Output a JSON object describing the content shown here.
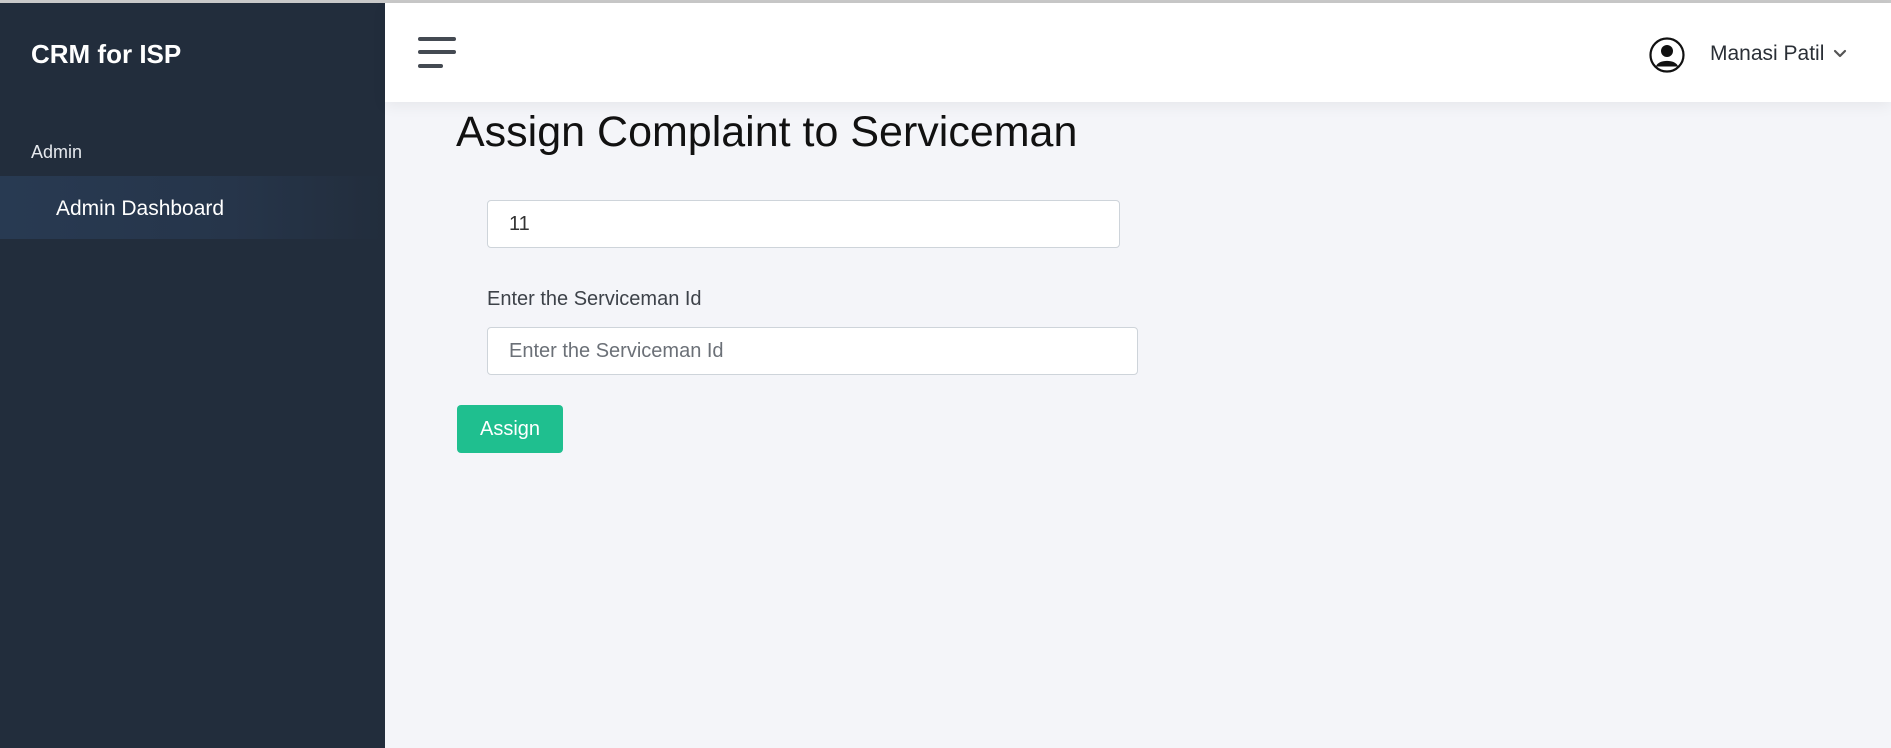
{
  "sidebar": {
    "brand": "CRM for ISP",
    "section_label": "Admin",
    "items": [
      {
        "label": "Admin Dashboard"
      }
    ],
    "background": "#222d3c"
  },
  "topbar": {
    "menu_icon": "hamburger-icon",
    "user_icon": "user-circle-icon",
    "user_name": "Manasi Patil",
    "dropdown_icon": "chevron-down-icon"
  },
  "main": {
    "title": "Assign Complaint to Serviceman",
    "complaint_field": {
      "value": "11"
    },
    "serviceman_field": {
      "label": "Enter the Serviceman Id",
      "placeholder": "Enter the Serviceman Id",
      "value": ""
    },
    "assign_button": {
      "label": "Assign",
      "color": "#1fbf8f"
    }
  }
}
